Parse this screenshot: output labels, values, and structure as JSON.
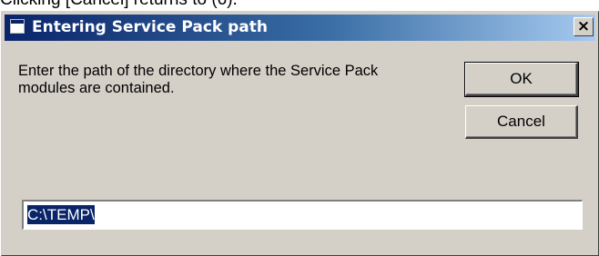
{
  "top_text": "Clicking [Cancel] returns to (6).",
  "dialog": {
    "title": "Entering Service Pack path",
    "close_label": "×",
    "message": "Enter the path of the directory where the Service Pack modules are contained.",
    "ok_label": "OK",
    "cancel_label": "Cancel",
    "path_value": "C:\\TEMP\\"
  },
  "colors": {
    "dialog_face": "#d4d0c8",
    "title_gradient_start": "#0a246a",
    "title_gradient_end": "#a6caf0",
    "selection": "#0a246a"
  }
}
